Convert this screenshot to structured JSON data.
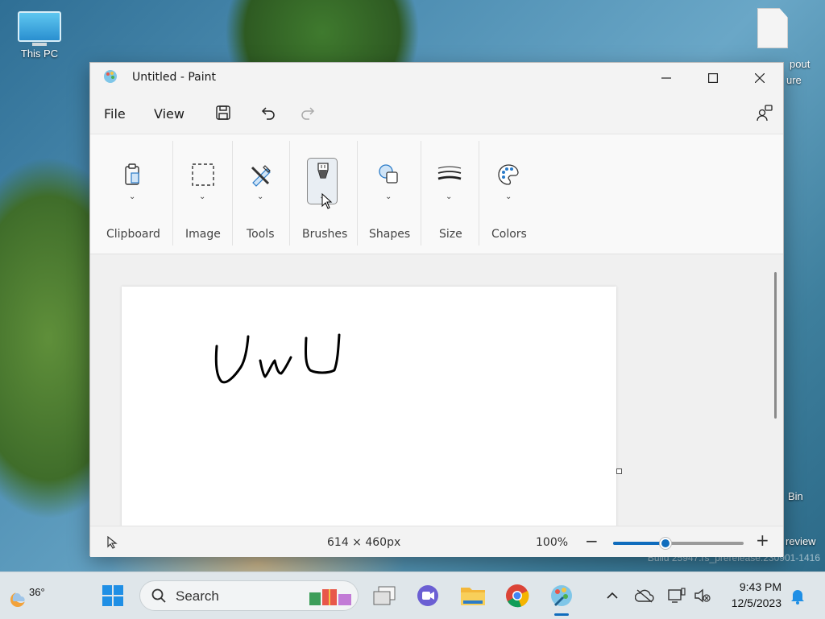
{
  "desktop": {
    "this_pc_label": "This PC",
    "right_edge_texts": [
      "pout",
      "ure",
      "Bin",
      "review"
    ],
    "watermark": "Build 25947.rs_prerelease.230901-1416"
  },
  "window": {
    "title": "Untitled - Paint",
    "menu": {
      "file": "File",
      "view": "View"
    }
  },
  "ribbon": {
    "groups": [
      {
        "label": "Clipboard",
        "icon": "clipboard-icon"
      },
      {
        "label": "Image",
        "icon": "selection-icon"
      },
      {
        "label": "Tools",
        "icon": "tools-icon"
      },
      {
        "label": "Brushes",
        "icon": "brush-icon",
        "selected": true
      },
      {
        "label": "Shapes",
        "icon": "shapes-icon"
      },
      {
        "label": "Size",
        "icon": "size-lines-icon"
      },
      {
        "label": "Colors",
        "icon": "palette-icon"
      }
    ]
  },
  "statusbar": {
    "canvas_size": "614 × 460px",
    "zoom": "100%",
    "zoom_slider_fraction": 0.4
  },
  "taskbar": {
    "weather_temp": "36°",
    "search_placeholder": "Search",
    "time": "9:43 PM",
    "date": "12/5/2023"
  },
  "colors": {
    "accent": "#0f6cbd"
  }
}
